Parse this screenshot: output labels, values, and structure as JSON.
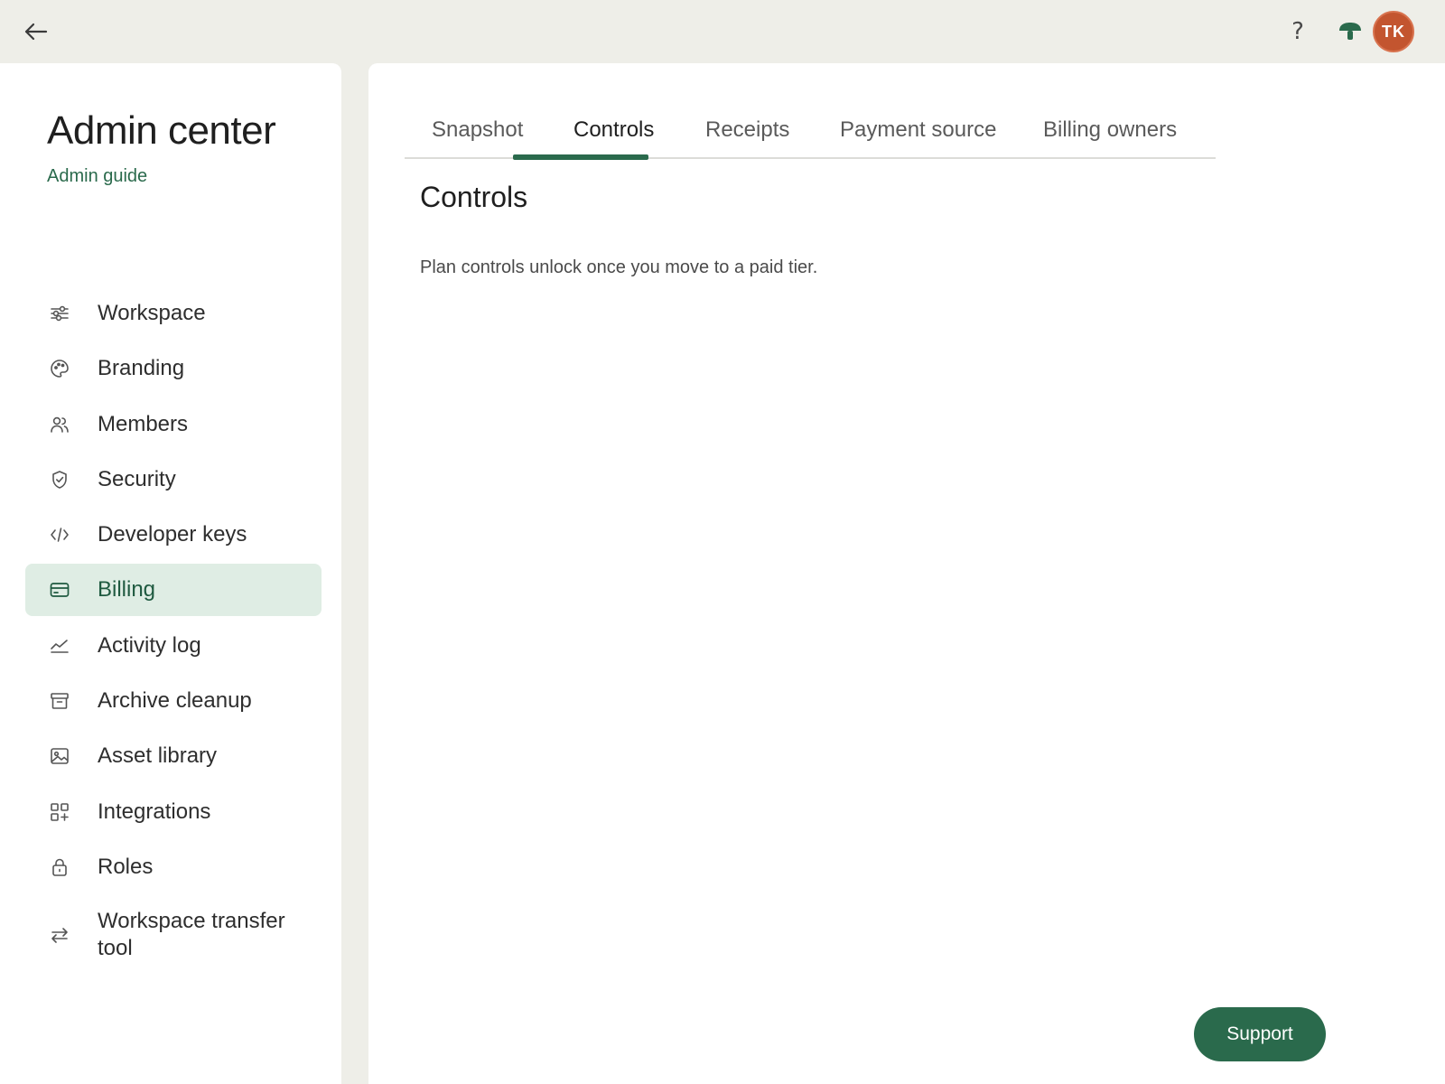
{
  "topbar": {
    "back_icon": "arrow-left-icon",
    "help_label": "?",
    "mushroom_icon": "mushroom-icon",
    "avatar_initials": "TK",
    "avatar_color": "#c3552f"
  },
  "sidebar": {
    "title": "Admin center",
    "guide_link": "Admin guide",
    "items": [
      {
        "label": "Workspace",
        "icon": "sliders-icon"
      },
      {
        "label": "Branding",
        "icon": "palette-icon"
      },
      {
        "label": "Members",
        "icon": "users-icon"
      },
      {
        "label": "Security",
        "icon": "shield-check-icon"
      },
      {
        "label": "Developer keys",
        "icon": "code-icon"
      },
      {
        "label": "Billing",
        "icon": "credit-card-icon",
        "active": true
      },
      {
        "label": "Activity log",
        "icon": "line-chart-icon"
      },
      {
        "label": "Archive cleanup",
        "icon": "archive-icon"
      },
      {
        "label": "Asset library",
        "icon": "image-icon"
      },
      {
        "label": "Integrations",
        "icon": "apps-add-icon"
      },
      {
        "label": "Roles",
        "icon": "lock-icon"
      },
      {
        "label": "Workspace transfer tool",
        "icon": "transfer-arrows-icon"
      }
    ]
  },
  "main": {
    "tabs": [
      {
        "label": "Snapshot"
      },
      {
        "label": "Controls",
        "active": true
      },
      {
        "label": "Receipts"
      },
      {
        "label": "Payment source"
      },
      {
        "label": "Billing owners"
      }
    ],
    "section_title": "Controls",
    "section_description": "Plan controls unlock once you move to a paid tier.",
    "support_button": "Support"
  },
  "colors": {
    "accent": "#2a6a4c",
    "active_nav_bg": "#dfede4",
    "page_bg": "#eeeee8"
  }
}
